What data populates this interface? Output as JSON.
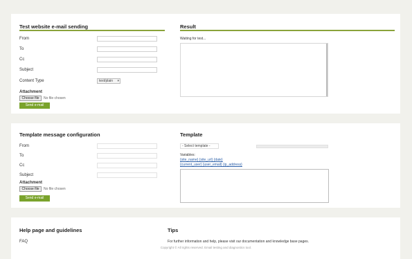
{
  "email_panel": {
    "title": "Test website e-mail sending",
    "fields": [
      {
        "label": "From",
        "value": ""
      },
      {
        "label": "To",
        "value": ""
      },
      {
        "label": "Cc",
        "value": ""
      },
      {
        "label": "Subject",
        "value": ""
      },
      {
        "label": "Content Type",
        "value": "text/plain"
      }
    ],
    "attachment_label": "Attachment",
    "choose_file": "Choose file",
    "no_file": "No file chosen",
    "send_button": "Send e-mail"
  },
  "result_panel": {
    "title": "Result",
    "text": "Waiting for test..."
  },
  "template_panel": {
    "title": "Template message configuration",
    "fields": [
      {
        "label": "From",
        "value": ""
      },
      {
        "label": "To",
        "value": ""
      },
      {
        "label": "Cc",
        "value": ""
      },
      {
        "label": "Subject",
        "value": ""
      }
    ],
    "attachment_label": "Attachment",
    "choose_file": "Choose file",
    "no_file": "No file chosen",
    "send_button": "Send e-mail"
  },
  "template_box": {
    "title": "Template",
    "selected": "- Select template -",
    "variables_label": "Variables:",
    "link1": "{site_name} {site_url} {date}",
    "link2": "{current_user} {user_email} {ip_address}"
  },
  "help_panel": {
    "title": "Help page and guidelines",
    "subitem": "FAQ",
    "right_title": "Tips",
    "right_text": "For further information and help, please visit our documentation and knowledge base pages."
  },
  "footer": {
    "text": "Copyright © All rights reserved. Email testing and diagnostics tool."
  }
}
